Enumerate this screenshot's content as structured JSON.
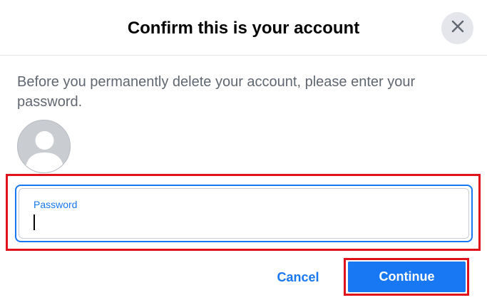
{
  "dialog": {
    "title": "Confirm this is your account",
    "description": "Before you permanently delete your account, please enter your password."
  },
  "password_field": {
    "label": "Password",
    "value": "",
    "placeholder": ""
  },
  "actions": {
    "cancel_label": "Cancel",
    "continue_label": "Continue"
  },
  "icons": {
    "close": "close-icon",
    "avatar": "default-avatar-icon"
  },
  "colors": {
    "accent": "#1877f2",
    "highlight": "#e0121b",
    "close_bg": "#e4e6eb"
  }
}
